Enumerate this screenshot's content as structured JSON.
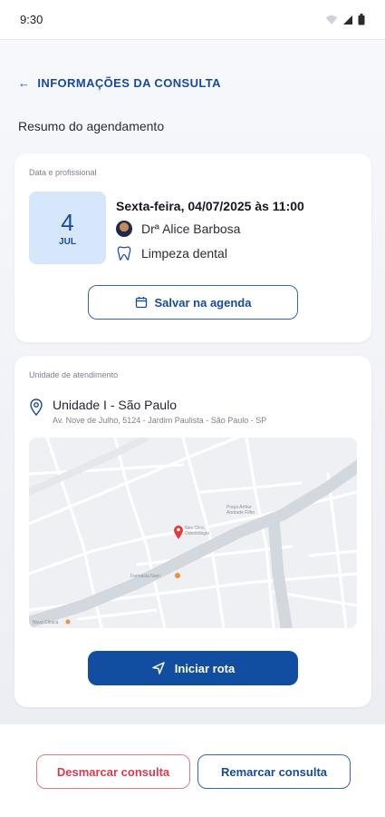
{
  "status_bar": {
    "time": "9:30",
    "icons": [
      "wifi-icon",
      "signal-icon",
      "battery-icon"
    ]
  },
  "header": {
    "back_icon": "arrow-left-icon",
    "title": "INFORMAÇÕES DA CONSULTA"
  },
  "summary": {
    "section_title": "Resumo do agendamento"
  },
  "appointment_card": {
    "label": "Data e profissional",
    "date": {
      "day": "4",
      "month": "JUL"
    },
    "datetime": "Sexta-feira, 04/07/2025 às 11:00",
    "professional": "Drª Alice Barbosa",
    "service": "Limpeza dental",
    "save_button": "Salvar na agenda"
  },
  "unit_card": {
    "label": "Unidade de atendimento",
    "unit_name": "Unidade I - São Paulo",
    "address": "Av. Nove de Julho, 5124 - Jardim Paulista - São Paulo - SP",
    "map": {
      "pin_label_1": "Neo Clinic",
      "pin_label_2": "Odontologia",
      "place_1": "Farmácia Nam",
      "place_2": "Praça Arthur",
      "place_3": "Andrade Filho",
      "place_4": "Nova Clínica"
    },
    "route_button": "Iniciar rota"
  },
  "footer": {
    "cancel_button": "Desmarcar consulta",
    "reschedule_button": "Remarcar consulta"
  },
  "colors": {
    "primary": "#114da0",
    "accent_light": "#d6e6fb",
    "danger": "#d83b4e",
    "pin": "#e23b3b"
  }
}
